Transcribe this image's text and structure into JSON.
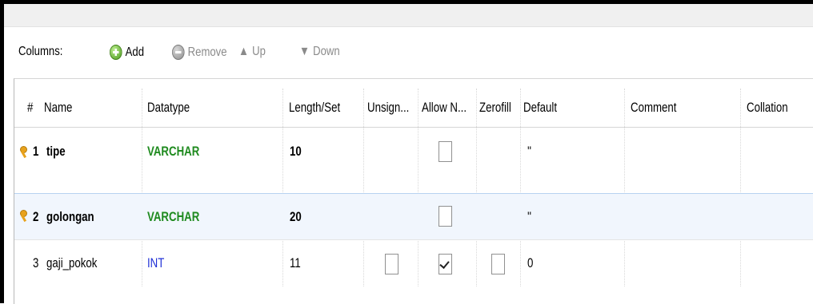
{
  "toolbar": {
    "columns_label": "Columns:",
    "add_label": "Add",
    "remove_label": "Remove",
    "up_label": "Up",
    "down_label": "Down"
  },
  "table": {
    "headers": [
      "#",
      "Name",
      "Datatype",
      "Length/Set",
      "Unsign...",
      "Allow N...",
      "Zerofill",
      "Default",
      "Comment",
      "Collation"
    ],
    "rows": [
      {
        "num": "1",
        "name": "tipe",
        "datatype": "VARCHAR",
        "length": "10",
        "unsigned": false,
        "allow_null": false,
        "zerofill": false,
        "default": "''",
        "comment": "",
        "collation": "",
        "primary_key": true
      },
      {
        "num": "2",
        "name": "golongan",
        "datatype": "VARCHAR",
        "length": "20",
        "unsigned": false,
        "allow_null": false,
        "zerofill": false,
        "default": "''",
        "comment": "",
        "collation": "",
        "primary_key": true
      },
      {
        "num": "3",
        "name": "gaji_pokok",
        "datatype": "INT",
        "length": "11",
        "unsigned": false,
        "allow_null": true,
        "zerofill": false,
        "default": "0",
        "comment": "",
        "collation": "",
        "primary_key": false
      }
    ]
  },
  "colors": {
    "varchar": "#1e8a1e",
    "int": "#1f2fd6",
    "selected_row": "#f1f6fd",
    "key_icon": "#e8a21c"
  }
}
